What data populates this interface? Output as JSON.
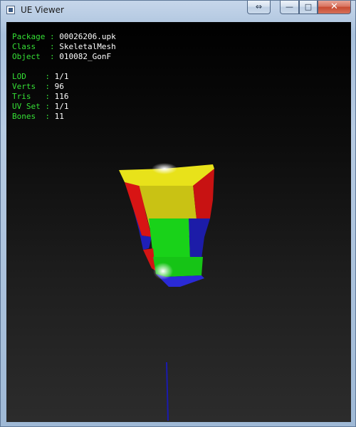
{
  "window": {
    "title": "UE Viewer",
    "buttons": {
      "resize": "⇔",
      "minimize": "—",
      "maximize": "□",
      "close": "✕"
    }
  },
  "info": {
    "package_label": "Package",
    "package_value": "00026206.upk",
    "class_label": "Class",
    "class_value": "SkeletalMesh",
    "object_label": "Object",
    "object_value": "010082_GonF",
    "lod_label": "LOD",
    "lod_value": "1/1",
    "verts_label": "Verts",
    "verts_value": "96",
    "tris_label": "Tris",
    "tris_value": "116",
    "uvset_label": "UV Set",
    "uvset_value": "1/1",
    "bones_label": "Bones",
    "bones_value": "11"
  },
  "colors": {
    "label": "#35e035",
    "value": "#ffffff",
    "mesh_yellow": "#e6df10",
    "mesh_green": "#22e622",
    "mesh_red": "#e01515",
    "mesh_blue": "#2020c8"
  }
}
